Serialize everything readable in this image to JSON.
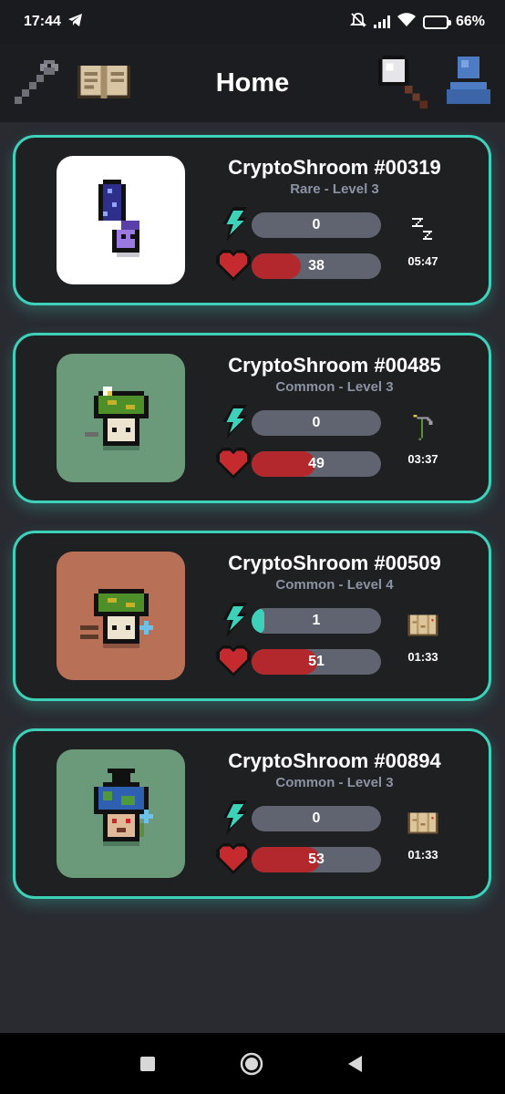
{
  "status_bar": {
    "time": "17:44",
    "battery": "66%",
    "battery_level": 0.66
  },
  "header": {
    "title": "Home",
    "icons": [
      "wrench-icon",
      "book-icon",
      "magnifier-icon",
      "profile-icon"
    ]
  },
  "colors": {
    "accent": "#3ed1ba",
    "health": "#b3282c",
    "bar_track": "#5f6470",
    "card_bg": "#1f2022",
    "page_bg": "#292b31"
  },
  "cards": [
    {
      "name": "CryptoShroom #00319",
      "subtitle": "Rare - Level 3",
      "energy": "0",
      "energy_fraction": 0,
      "health": "38",
      "health_fraction": 0.38,
      "status_icon": "sleep-zzz-icon",
      "time": "05:47",
      "thumb_bg": "#ffffff"
    },
    {
      "name": "CryptoShroom #00485",
      "subtitle": "Common - Level 3",
      "energy": "0",
      "energy_fraction": 0,
      "health": "49",
      "health_fraction": 0.49,
      "status_icon": "scythe-icon",
      "time": "03:37",
      "thumb_bg": "#6b9a7b"
    },
    {
      "name": "CryptoShroom #00509",
      "subtitle": "Common - Level 4",
      "energy": "1",
      "energy_fraction": 0.1,
      "health": "51",
      "health_fraction": 0.51,
      "status_icon": "map-icon",
      "time": "01:33",
      "thumb_bg": "#b87156"
    },
    {
      "name": "CryptoShroom #00894",
      "subtitle": "Common - Level 3",
      "energy": "0",
      "energy_fraction": 0,
      "health": "53",
      "health_fraction": 0.53,
      "status_icon": "map-icon",
      "time": "01:33",
      "thumb_bg": "#6b9a7b"
    }
  ]
}
